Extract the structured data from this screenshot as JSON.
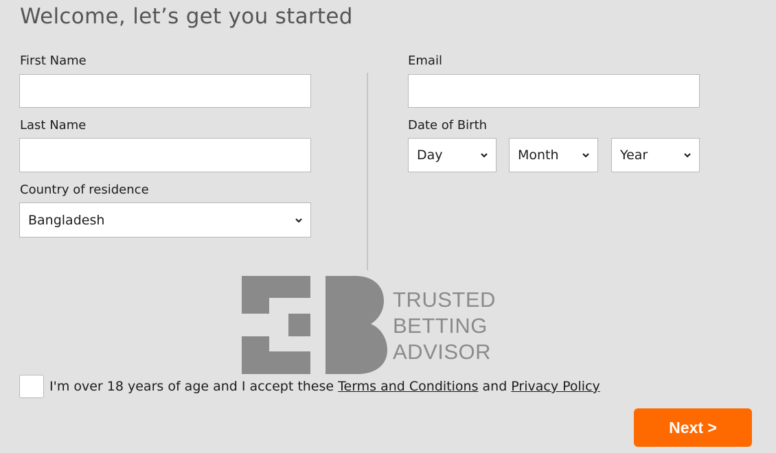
{
  "page": {
    "title": "Welcome, let’s get you started"
  },
  "form": {
    "first_name": {
      "label": "First Name",
      "value": ""
    },
    "last_name": {
      "label": "Last Name",
      "value": ""
    },
    "country": {
      "label": "Country of residence",
      "selected": "Bangladesh"
    },
    "email": {
      "label": "Email",
      "value": ""
    },
    "dob": {
      "label": "Date of Birth",
      "day": "Day",
      "month": "Month",
      "year": "Year"
    }
  },
  "watermark": {
    "icon": "tba-logo-icon",
    "line1": "TRUSTED",
    "line2": "BETTING",
    "line3": "ADVISOR",
    "color": "#8a8a8a"
  },
  "consent": {
    "checked": false,
    "text_before": "I'm over 18 years of age and I accept these ",
    "terms_link": "Terms and Conditions",
    "text_middle": " and ",
    "privacy_link": "Privacy Policy"
  },
  "actions": {
    "next_label": "Next >",
    "accent_color": "#ff6a00"
  }
}
